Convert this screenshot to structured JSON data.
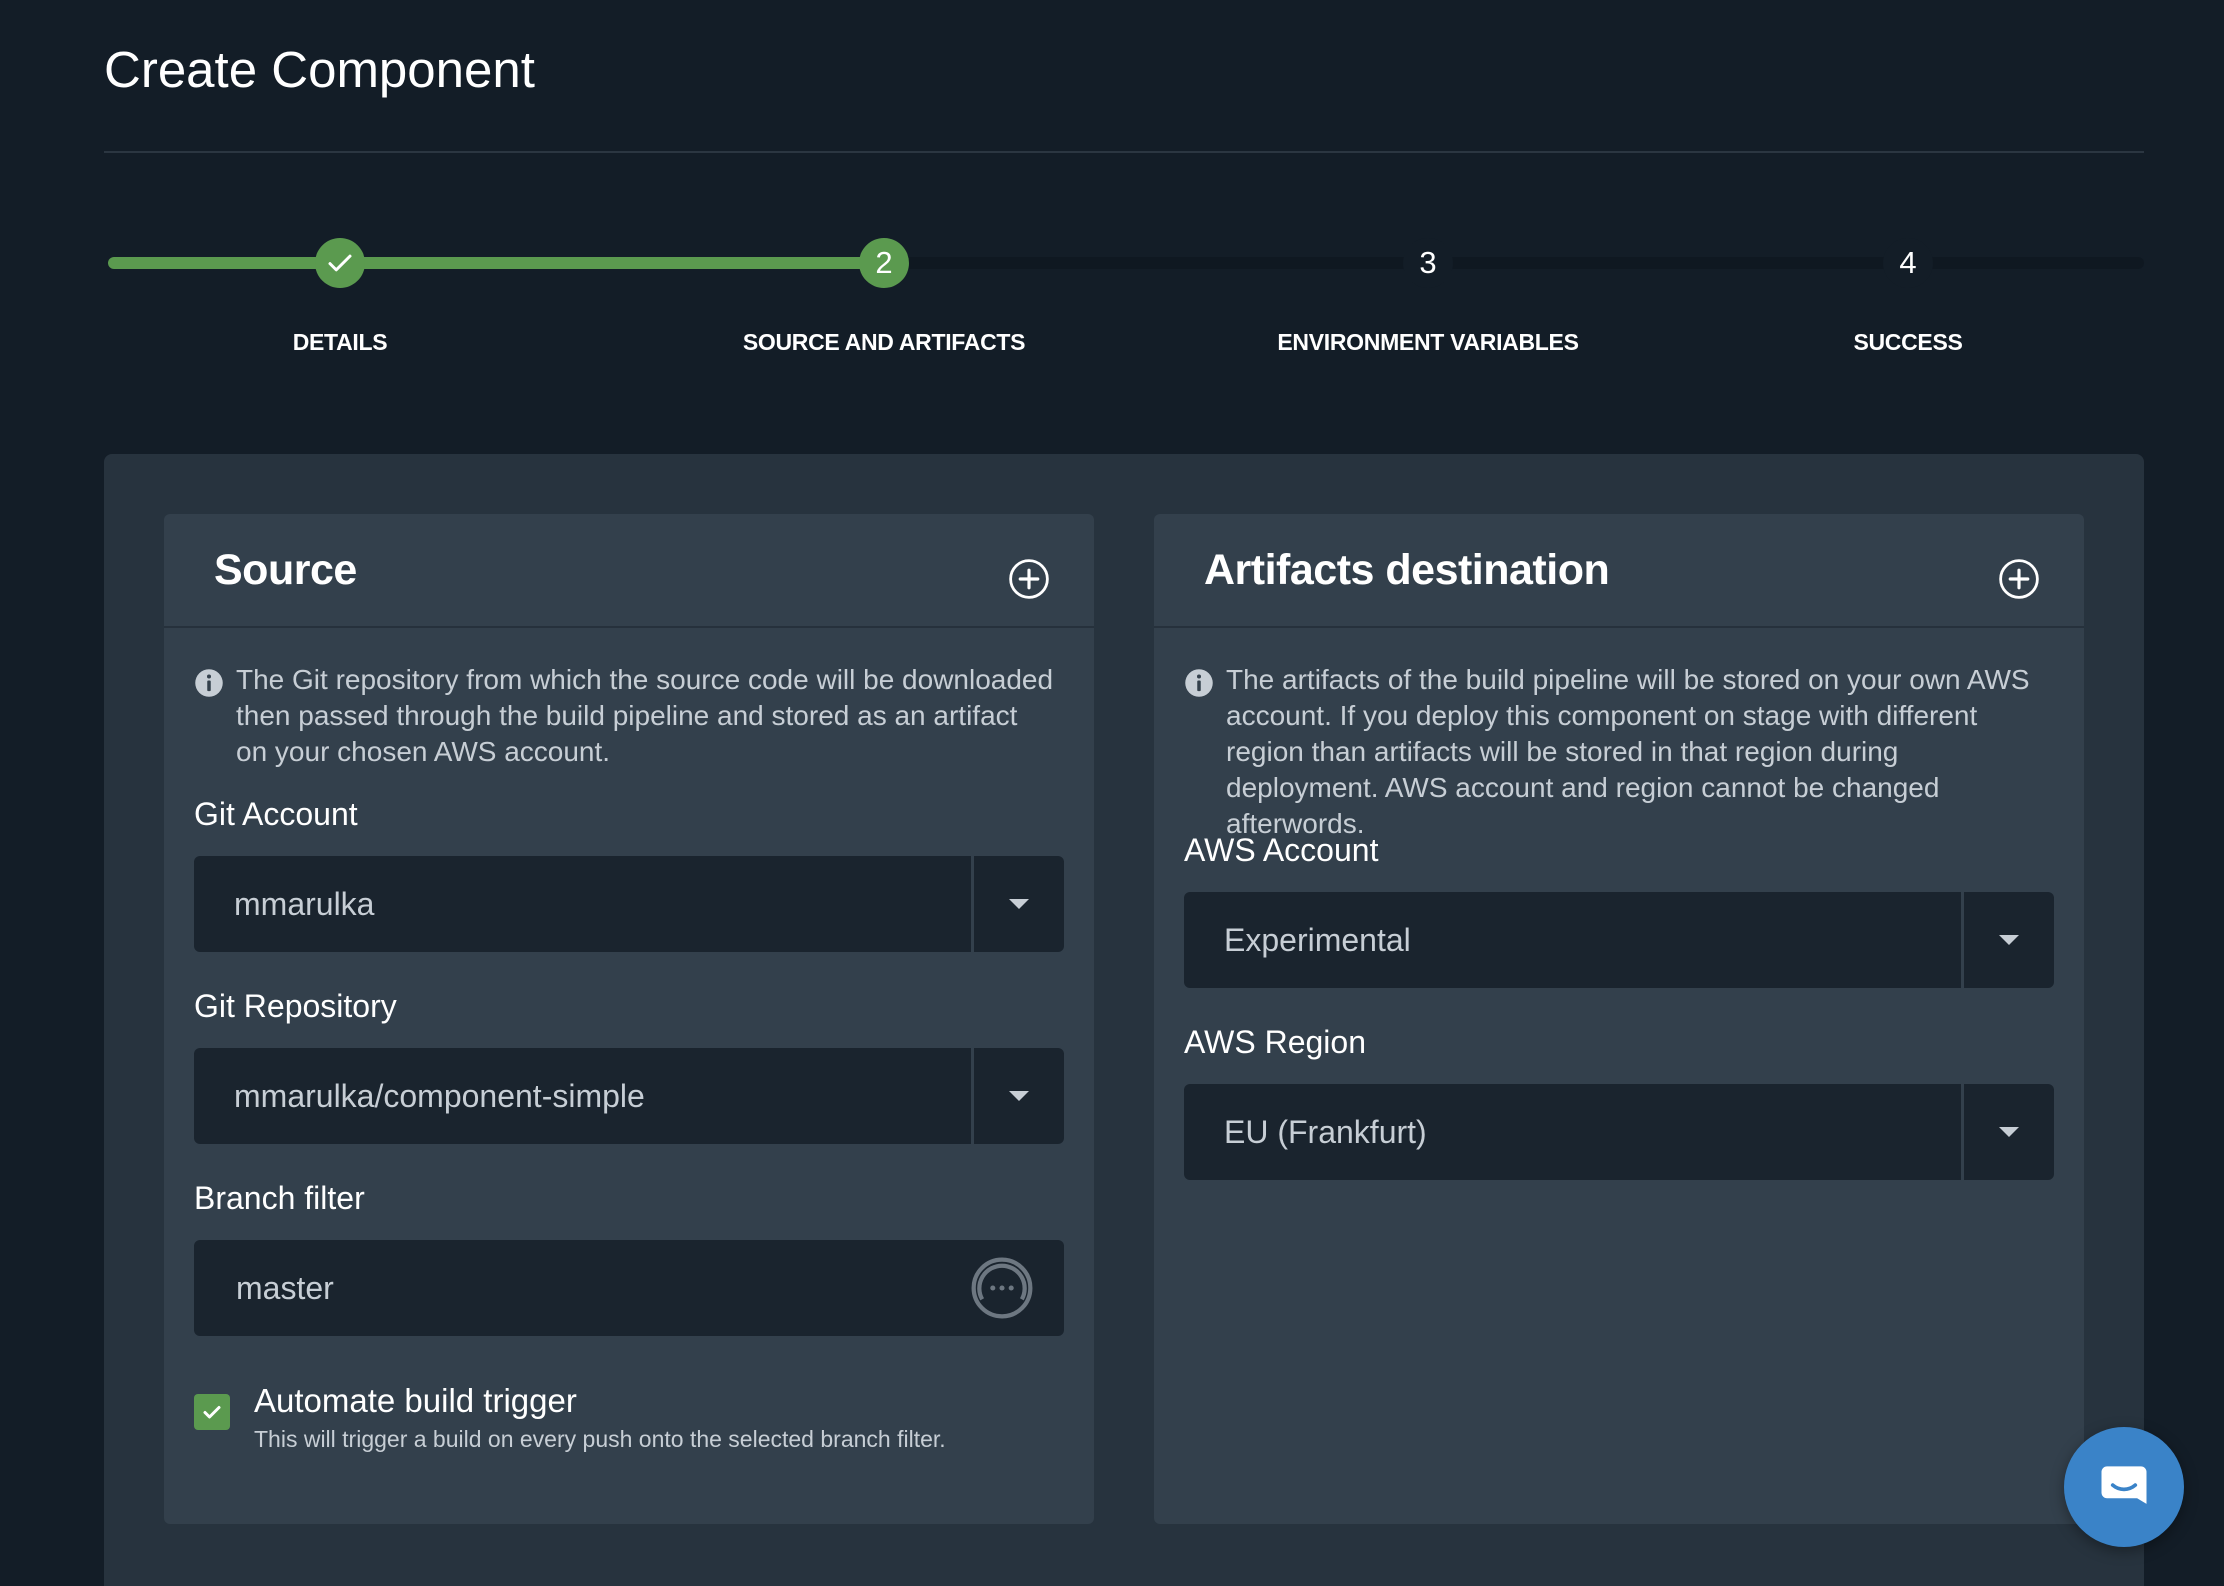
{
  "page": {
    "title": "Create Component"
  },
  "stepper": {
    "steps": [
      {
        "number": "1",
        "label": "DETAILS",
        "state": "done"
      },
      {
        "number": "2",
        "label": "SOURCE AND ARTIFACTS",
        "state": "active"
      },
      {
        "number": "3",
        "label": "ENVIRONMENT VARIABLES",
        "state": "pending"
      },
      {
        "number": "4",
        "label": "SUCCESS",
        "state": "pending"
      }
    ]
  },
  "source": {
    "title": "Source",
    "info": "The Git repository from which the source code will be downloaded then passed through the build pipeline and stored as an artifact on your chosen AWS account.",
    "git_account": {
      "label": "Git Account",
      "value": "mmarulka"
    },
    "git_repository": {
      "label": "Git Repository",
      "value": "mmarulka/component-simple"
    },
    "branch_filter": {
      "label": "Branch filter",
      "value": "master"
    },
    "automate": {
      "label": "Automate build trigger",
      "help": "This will trigger a build on every push onto the selected branch filter.",
      "checked": true
    }
  },
  "artifacts": {
    "title": "Artifacts destination",
    "info": "The artifacts of the build pipeline will be stored on your own AWS account. If you deploy this component on stage with different region than artifacts will be stored in that region during deployment. AWS account and region cannot be changed afterwords.",
    "aws_account": {
      "label": "AWS Account",
      "value": "Experimental"
    },
    "aws_region": {
      "label": "AWS Region",
      "value": "EU (Frankfurt)"
    }
  },
  "colors": {
    "background": "#131d27",
    "card": "#27333e",
    "panel": "#33404c",
    "input": "#1a242e",
    "accent_green": "#5b9a4f",
    "chat_blue": "#3a83c8"
  },
  "icons": {
    "step_done": "check-icon",
    "panel_add": "plus-circle-icon",
    "info": "info-icon",
    "select_caret": "caret-down-icon",
    "password_manager": "password-manager-icon",
    "chat": "chat-icon"
  }
}
